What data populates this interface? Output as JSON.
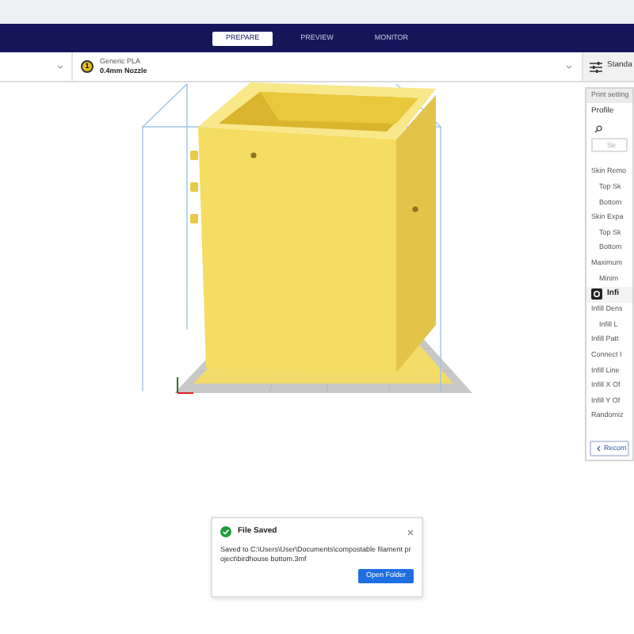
{
  "tabs": [
    {
      "label": "PREPARE",
      "selected": true
    },
    {
      "label": "PREVIEW",
      "selected": false
    },
    {
      "label": "MONITOR",
      "selected": false
    }
  ],
  "material": {
    "badge": "1",
    "name": "Generic PLA",
    "nozzle": "0.4mm Nozzle"
  },
  "print_settings_button": {
    "label": "Standa"
  },
  "settings_panel": {
    "title": "Print setting",
    "profile_label": "Profile",
    "search": {
      "placeholder": "Se"
    },
    "items": [
      {
        "kind": "setting",
        "label": "Skin Remo",
        "children": [
          {
            "kind": "setting",
            "label": "Top Sk"
          },
          {
            "kind": "setting",
            "label": "Bottom"
          }
        ]
      },
      {
        "kind": "setting",
        "label": "Skin Expa",
        "children": [
          {
            "kind": "setting",
            "label": "Top Sk"
          },
          {
            "kind": "setting",
            "label": "Bottom"
          }
        ]
      },
      {
        "kind": "setting",
        "label": "Maximum",
        "children": [
          {
            "kind": "setting",
            "label": "Minim"
          }
        ]
      },
      {
        "kind": "category",
        "label": "Infi"
      },
      {
        "kind": "setting",
        "label": "Infill Dens",
        "children": [
          {
            "kind": "setting",
            "label": "Infill L"
          }
        ]
      },
      {
        "kind": "setting",
        "label": "Infill Patt"
      },
      {
        "kind": "setting",
        "label": "Connect I"
      },
      {
        "kind": "setting",
        "label": "Infill Line"
      },
      {
        "kind": "setting",
        "label": "Infill X Of"
      },
      {
        "kind": "setting",
        "label": "Infill Y Of"
      },
      {
        "kind": "setting",
        "label": "Randomiz"
      }
    ],
    "recommended_button": {
      "label": "Recom"
    }
  },
  "notification": {
    "title": "File Saved",
    "message": "Saved to C:\\Users\\User\\Documents\\compostable filament project\\birdhouse bottom.3mf",
    "button": "Open Folder"
  }
}
